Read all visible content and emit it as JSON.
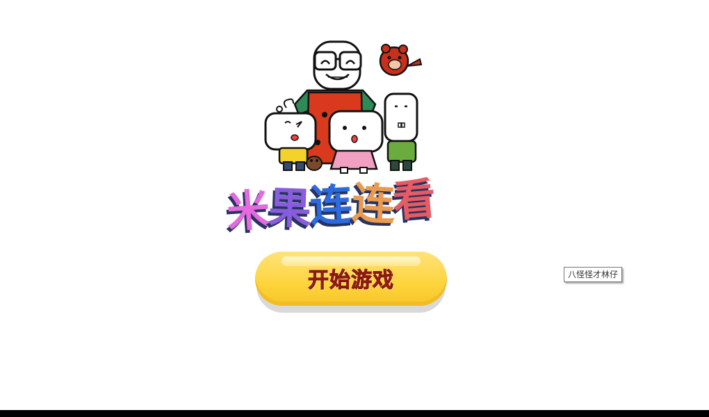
{
  "game": {
    "title_chars": [
      "米",
      "果",
      "连",
      "连",
      "看"
    ],
    "start_button_label": "开始游戏"
  },
  "tooltip": {
    "text": "八怪怪才林仔"
  },
  "colors": {
    "title": [
      "#ee6ee9",
      "#8f61e8",
      "#2f6fe8",
      "#f4a255",
      "#f0606a"
    ],
    "title_shadow": "#27345f",
    "button_fill": "#fdd43b",
    "button_text": "#c0271f"
  },
  "icons": {
    "mascot_group": "cartoon-family-illustration"
  }
}
